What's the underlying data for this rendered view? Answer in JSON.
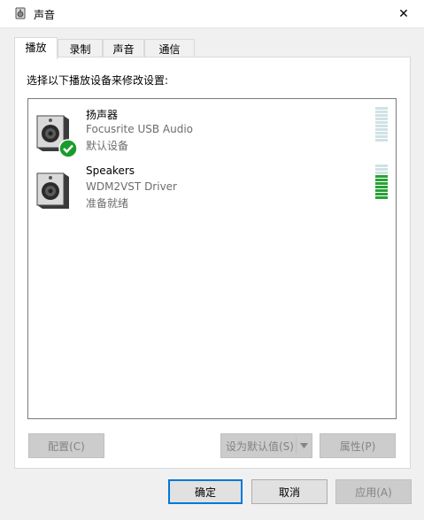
{
  "window": {
    "title": "声音",
    "close_glyph": "✕"
  },
  "tabs": [
    {
      "label": "播放",
      "active": true
    },
    {
      "label": "录制",
      "active": false
    },
    {
      "label": "声音",
      "active": false
    },
    {
      "label": "通信",
      "active": false
    }
  ],
  "instruction": "选择以下播放设备来修改设置:",
  "devices": [
    {
      "name": "扬声器",
      "driver": "Focusrite USB Audio",
      "status": "默认设备",
      "is_default": true,
      "level": 0.0
    },
    {
      "name": "Speakers",
      "driver": "WDM2VST Driver",
      "status": "准备就绪",
      "is_default": false,
      "level": 0.7
    }
  ],
  "buttons": {
    "configure": "配置(C)",
    "set_default": "设为默认值(S)",
    "properties": "属性(P)",
    "ok": "确定",
    "cancel": "取消",
    "apply": "应用(A)"
  },
  "colors": {
    "meter_off": "#cfe2e6",
    "meter_on": "#2aa236",
    "check_green": "#1a9c2c",
    "focus_blue": "#0078d7"
  }
}
